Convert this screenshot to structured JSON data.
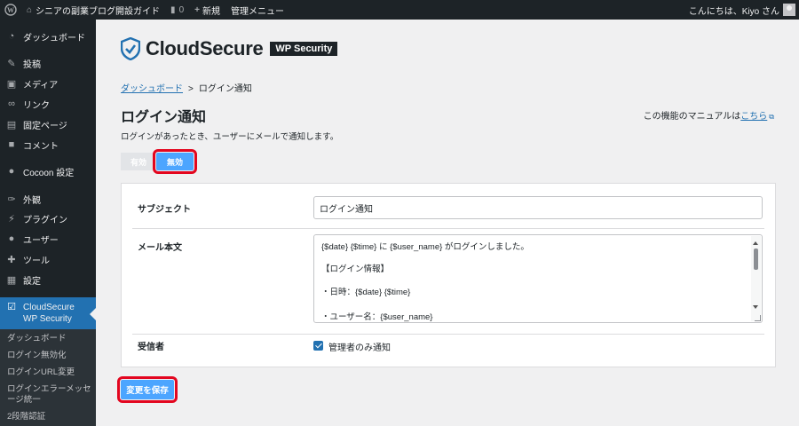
{
  "adminbar": {
    "site_name": "シニアの副業ブログ開設ガイド",
    "comments_count": "0",
    "new_label": "新規",
    "manage_label": "管理メニュー",
    "greeting": "こんにちは、Kiyo さん"
  },
  "sidebar": {
    "items": [
      {
        "label": "ダッシュボード",
        "icon": "dashboard-icon"
      },
      {
        "label": "投稿",
        "icon": "pin-icon"
      },
      {
        "label": "メディア",
        "icon": "media-icon"
      },
      {
        "label": "リンク",
        "icon": "link-icon"
      },
      {
        "label": "固定ページ",
        "icon": "page-icon"
      },
      {
        "label": "コメント",
        "icon": "comment-icon"
      },
      {
        "label": "Cocoon 設定",
        "icon": "cocoon-icon"
      },
      {
        "label": "外観",
        "icon": "brush-icon"
      },
      {
        "label": "プラグイン",
        "icon": "plugin-icon"
      },
      {
        "label": "ユーザー",
        "icon": "user-icon"
      },
      {
        "label": "ツール",
        "icon": "wrench-icon"
      },
      {
        "label": "設定",
        "icon": "settings-icon"
      }
    ],
    "current": {
      "label": "CloudSecure WP Security",
      "icon": "shield-check-icon"
    },
    "submenu": [
      "ダッシュボード",
      "ログイン無効化",
      "ログインURL変更",
      "ログインエラーメッセージ統一",
      "2段階認証"
    ]
  },
  "brand": {
    "name": "CloudSecure",
    "badge": "WP Security"
  },
  "breadcrumb": {
    "link": "ダッシュボード",
    "separator": ">",
    "current": "ログイン通知"
  },
  "page": {
    "title": "ログイン通知",
    "manual_prefix": "この機能のマニュアルは",
    "manual_link": "こちら",
    "description": "ログインがあったとき、ユーザーにメールで通知します。"
  },
  "toggle": {
    "enabled": "有効",
    "disabled": "無効"
  },
  "form": {
    "subject_label": "サブジェクト",
    "subject_value": "ログイン通知",
    "body_label": "メール本文",
    "body_lines": [
      "{$date} {$time} に {$user_name} がログインしました。",
      "【ログイン情報】",
      "・日時：{$date} {$time}",
      "・ユーザー名：{$user_name}"
    ],
    "recipient_label": "受信者",
    "recipient_option": "管理者のみ通知",
    "recipient_checked": true
  },
  "save_label": "変更を保存",
  "colors": {
    "accent": "#4ca5ff",
    "highlight": "#e3061f",
    "link": "#2271b1",
    "admin_dark": "#1d2327"
  }
}
